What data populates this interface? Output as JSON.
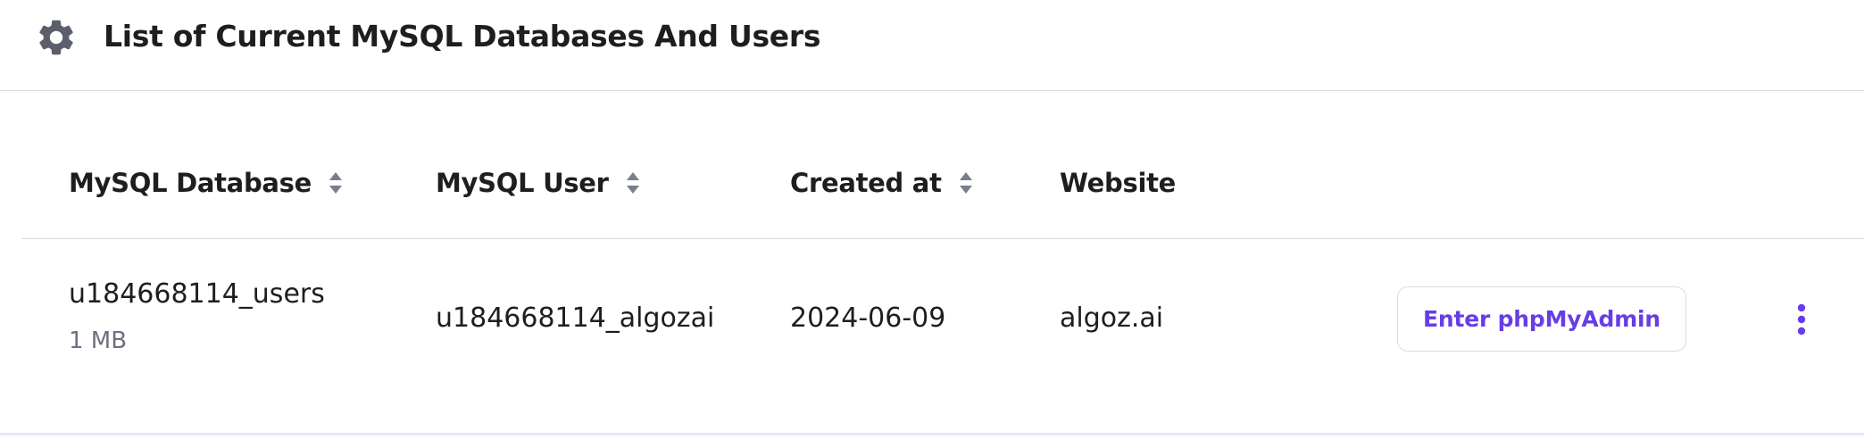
{
  "header": {
    "title": "List of Current MySQL Databases And Users",
    "icon": "gear-icon"
  },
  "table": {
    "columns": [
      {
        "label": "MySQL Database",
        "sortable": true
      },
      {
        "label": "MySQL User",
        "sortable": true
      },
      {
        "label": "Created at",
        "sortable": true
      },
      {
        "label": "Website",
        "sortable": false
      }
    ],
    "rows": [
      {
        "database": "u184668114_users",
        "size": "1 MB",
        "user": "u184668114_algozai",
        "created_at": "2024-06-09",
        "website": "algoz.ai",
        "action_label": "Enter phpMyAdmin"
      }
    ]
  },
  "colors": {
    "accent": "#673de6",
    "icon_gray": "#5c5e6b",
    "divider": "#d8dae0",
    "muted_text": "#6d7081"
  }
}
